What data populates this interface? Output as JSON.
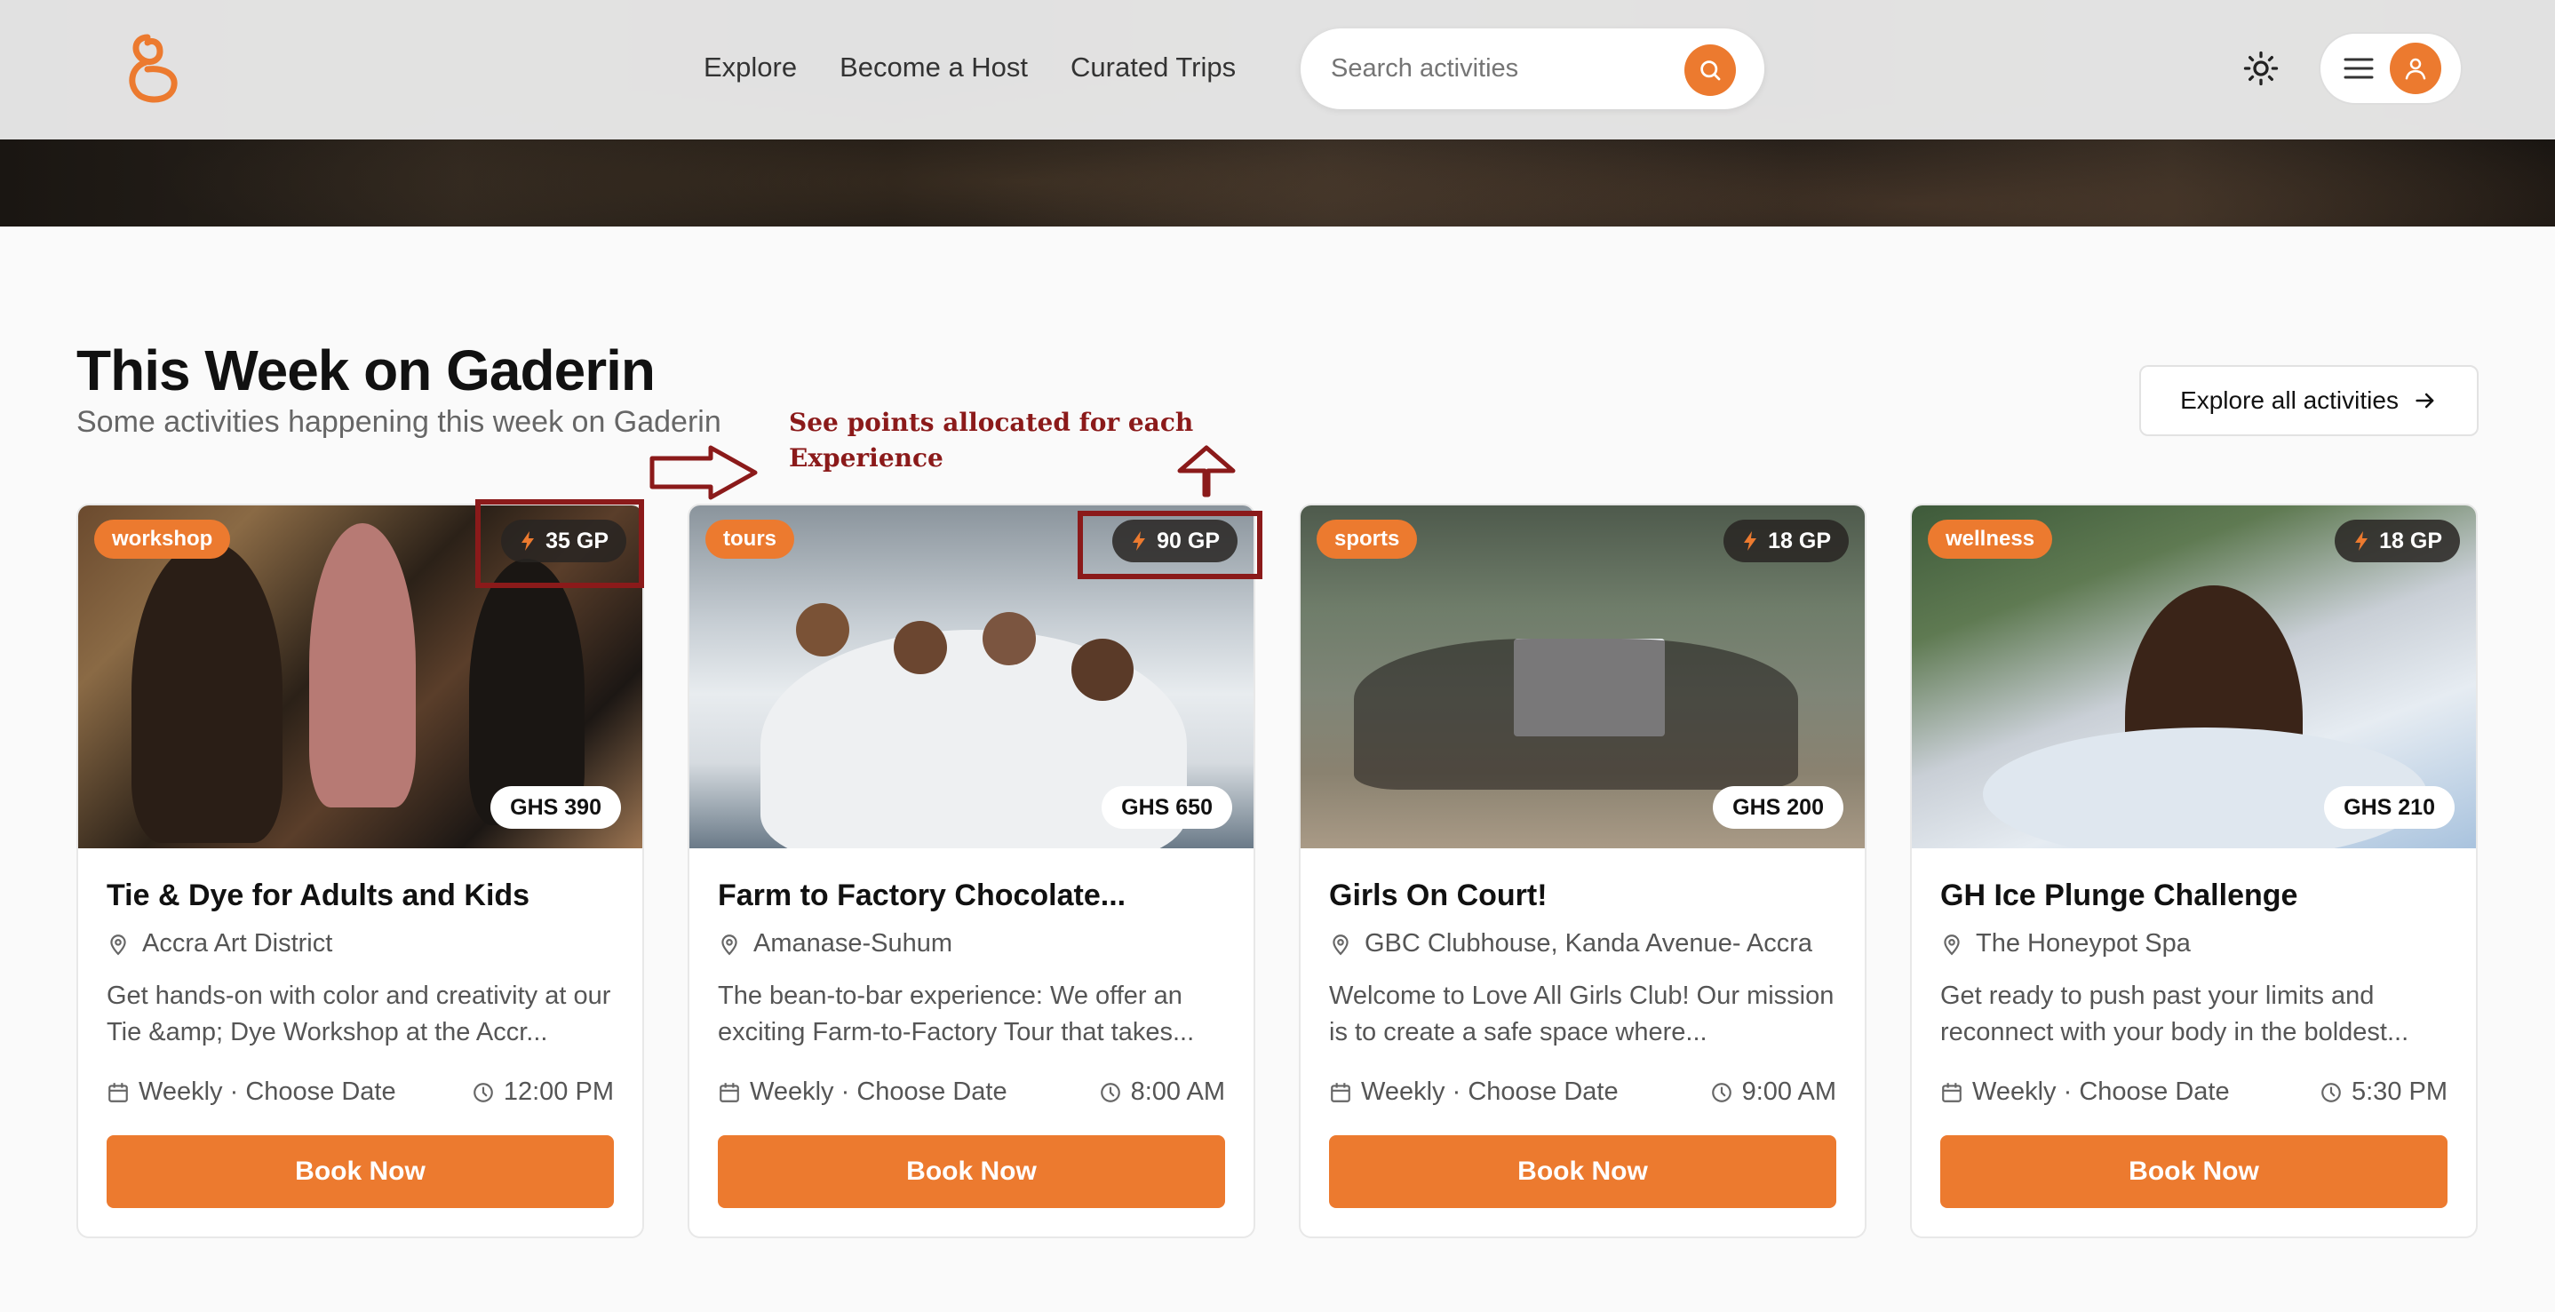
{
  "header": {
    "logo_alt": "Gaderin",
    "nav": [
      "Explore",
      "Become a Host",
      "Curated Trips"
    ],
    "search_placeholder": "Search activities"
  },
  "section": {
    "title": "This Week on Gaderin",
    "subtitle": "Some activities happening this week on Gaderin",
    "explore_all": "Explore all activities"
  },
  "annotation": {
    "text_line1": "See points allocated for each",
    "text_line2": "Experience",
    "color": "#8b1a1a"
  },
  "colors": {
    "accent": "#ec7a2f"
  },
  "cards": [
    {
      "tag": "workshop",
      "points": "35 GP",
      "price": "GHS 390",
      "title": "Tie & Dye for Adults and Kids",
      "location": "Accra Art District",
      "description": "Get hands-on with color and creativity at our Tie &amp; Dye Workshop at the Accr...",
      "schedule": "Weekly · Choose Date",
      "time": "12:00 PM",
      "button": "Book Now"
    },
    {
      "tag": "tours",
      "points": "90 GP",
      "price": "GHS 650",
      "title": "Farm to Factory Chocolate...",
      "location": "Amanase-Suhum",
      "description": "The bean-to-bar experience: We offer an exciting Farm-to-Factory Tour that takes...",
      "schedule": "Weekly · Choose Date",
      "time": "8:00 AM",
      "button": "Book Now"
    },
    {
      "tag": "sports",
      "points": "18 GP",
      "price": "GHS 200",
      "title": "Girls On Court!",
      "location": "GBC Clubhouse, Kanda Avenue- Accra",
      "description": "Welcome to Love All Girls Club! Our mission is to create a safe space where...",
      "schedule": "Weekly · Choose Date",
      "time": "9:00 AM",
      "button": "Book Now"
    },
    {
      "tag": "wellness",
      "points": "18 GP",
      "price": "GHS 210",
      "title": "GH Ice Plunge Challenge",
      "location": "The Honeypot Spa",
      "description": "Get ready to push past your limits and reconnect with your body in the boldest...",
      "schedule": "Weekly · Choose Date",
      "time": "5:30 PM",
      "button": "Book Now"
    }
  ]
}
